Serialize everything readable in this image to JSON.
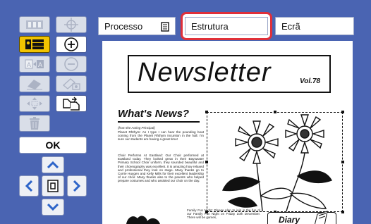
{
  "colors": {
    "background": "#4a64b2",
    "selected_tab_outline": "#e0303a",
    "tool_button": "#d9dee8",
    "active_tool_button": "#ffffff"
  },
  "toolbar": {
    "buttons": [
      {
        "name": "fit-page-icon",
        "state": "disabled"
      },
      {
        "name": "move-crosshair-icon",
        "state": "disabled"
      },
      {
        "name": "layout-columns-icon",
        "state": "selected"
      },
      {
        "name": "zoom-in-icon",
        "state": "enabled"
      },
      {
        "name": "page-compare-icon",
        "state": "disabled"
      },
      {
        "name": "zoom-out-icon",
        "state": "disabled"
      },
      {
        "name": "eraser-icon",
        "state": "disabled"
      },
      {
        "name": "fill-area-icon",
        "state": "disabled"
      },
      {
        "name": "pan-arrows-icon",
        "state": "disabled"
      },
      {
        "name": "copy-area-icon",
        "state": "enabled"
      },
      {
        "name": "trash-icon",
        "state": "disabled"
      }
    ],
    "ok_label": "OK",
    "nav": [
      "up-arrow-icon",
      "left-arrow-icon",
      "page-icon",
      "right-arrow-icon",
      "down-arrow-icon"
    ]
  },
  "tabs": {
    "processo": "Processo",
    "processo_icon": "document-icon",
    "estrutura": "Estrutura",
    "ecra": "Ecrã"
  },
  "newsletter": {
    "title": "Newsletter",
    "volume": "Vol.78",
    "whats_news": "What's News?",
    "source": "(from the Acting Principal)",
    "p1": "Planet Rhthym: As I type I can hear the pounding beat coming from the Planet Rhthym Incursion in the hall. I'm sure our students are having a great time!",
    "p2": "Choir Performs At Eastland: Our Choir performed at Eastland today. They looked great in their Bayswater Primary School Choir uniform, they sounded beautiful and their choreography was excellent. It is amazing how relaxed and professional they look on stage. Many thanks go to Corrie Huygen and Kelly Mills for their excellent leadership of our choir. Many thanks also to the parents who helped prepare costumes and who assisted our choir on the day.",
    "p3": "Family Fun Night: Please plan to join in the fun of our Family Fun Night on Friday 10th December. There will be games,",
    "diary": "Diary"
  }
}
